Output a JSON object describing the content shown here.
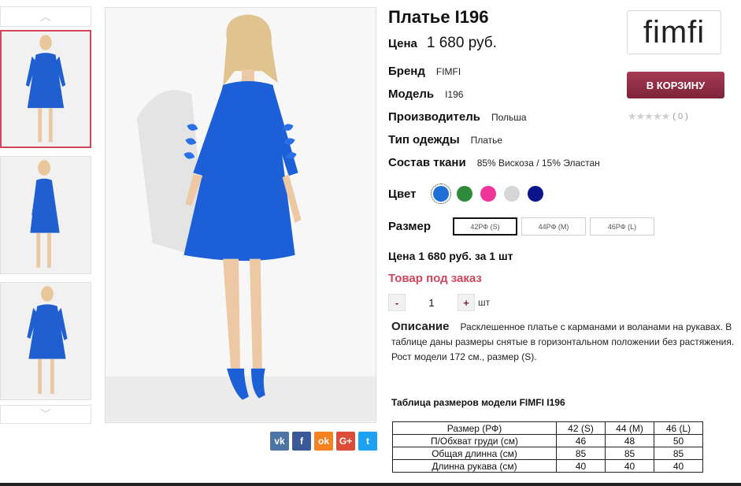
{
  "product": {
    "title": "Платье I196",
    "price_label": "Цена",
    "price_value": "1 680 руб.",
    "attributes": [
      {
        "label": "Бренд",
        "value": "FIMFI"
      },
      {
        "label": "Модель",
        "value": "I196"
      },
      {
        "label": "Производитель",
        "value": "Польша"
      },
      {
        "label": "Тип одежды",
        "value": "Платье"
      },
      {
        "label": "Состав ткани",
        "value": "85% Вискоза / 15% Эластан"
      }
    ],
    "color_label": "Цвет",
    "colors": [
      {
        "name": "blue",
        "hex": "#1f6fd6",
        "selected": true
      },
      {
        "name": "green",
        "hex": "#2e8b3c",
        "selected": false
      },
      {
        "name": "pink",
        "hex": "#f0359a",
        "selected": false
      },
      {
        "name": "light-gray",
        "hex": "#d6d6d6",
        "selected": false
      },
      {
        "name": "navy",
        "hex": "#0c148c",
        "selected": false
      }
    ],
    "size_label": "Размер",
    "sizes": [
      {
        "label": "42РФ (S)",
        "selected": true
      },
      {
        "label": "44РФ (M)",
        "selected": false
      },
      {
        "label": "46РФ (L)",
        "selected": false
      }
    ],
    "unit_price": "Цена 1 680 руб. за 1 шт",
    "status": "Товар под заказ",
    "quantity": {
      "minus": "-",
      "value": "1",
      "plus": "+",
      "unit": "шт"
    }
  },
  "brand": {
    "logo_text": "fimfi"
  },
  "cart": {
    "button_label": "В КОРЗИНУ"
  },
  "rating": {
    "stars": "★★★★★",
    "count": "( 0 )",
    "value": 0
  },
  "description": {
    "title": "Описание",
    "text": "Расклешенное платье с карманами и воланами на рукавах. В таблице даны размеры снятые в горизонтальном положении без растяжения.",
    "model_info": "Рост модели 172 см., размер (S)."
  },
  "size_table": {
    "title": "Таблица размеров модели FIMFI I196",
    "header": [
      "Размер (РФ)",
      "42 (S)",
      "44 (M)",
      "46 (L)"
    ],
    "rows": [
      [
        "П/Обхват груди (см)",
        "46",
        "48",
        "50"
      ],
      [
        "Общая длинна (см)",
        "85",
        "85",
        "85"
      ],
      [
        "Длинна рукава (см)",
        "40",
        "40",
        "40"
      ]
    ]
  },
  "share": [
    {
      "name": "vk",
      "label": "vk",
      "color": "#4c75a3"
    },
    {
      "name": "facebook",
      "label": "f",
      "color": "#3b5998"
    },
    {
      "name": "odnoklassniki",
      "label": "ok",
      "color": "#f58220"
    },
    {
      "name": "google-plus",
      "label": "G+",
      "color": "#dd4b39"
    },
    {
      "name": "twitter",
      "label": "t",
      "color": "#1da1f2"
    }
  ],
  "gallery": {
    "up_arrow": "︿",
    "down_arrow": "﹀"
  }
}
